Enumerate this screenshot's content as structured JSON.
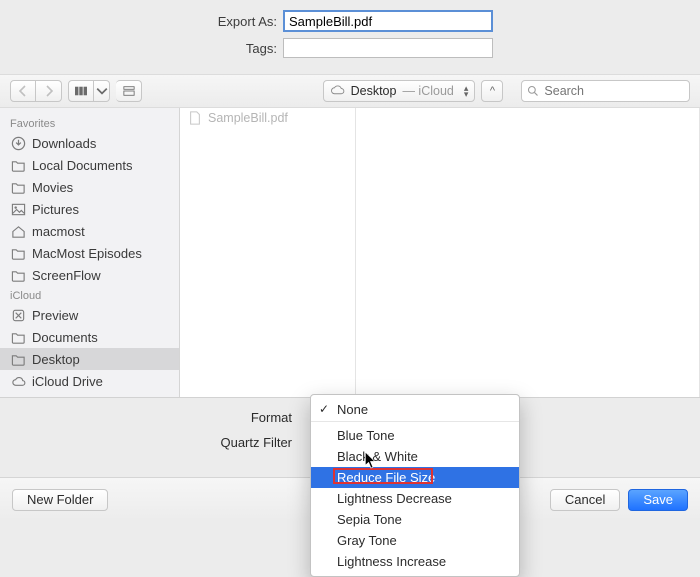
{
  "top": {
    "export_label": "Export As:",
    "export_value": "SampleBill.pdf",
    "tags_label": "Tags:"
  },
  "toolbar": {
    "location_main": "Desktop",
    "location_sub": " — iCloud",
    "search_placeholder": "Search"
  },
  "sidebar": {
    "sections": [
      {
        "header": "Favorites",
        "items": [
          {
            "label": "Downloads",
            "icon": "downloads"
          },
          {
            "label": "Local Documents",
            "icon": "folder"
          },
          {
            "label": "Movies",
            "icon": "folder"
          },
          {
            "label": "Pictures",
            "icon": "pictures"
          },
          {
            "label": "macmost",
            "icon": "home"
          },
          {
            "label": "MacMost Episodes",
            "icon": "folder"
          },
          {
            "label": "ScreenFlow",
            "icon": "folder"
          }
        ]
      },
      {
        "header": "iCloud",
        "items": [
          {
            "label": "Preview",
            "icon": "app"
          },
          {
            "label": "Documents",
            "icon": "folder"
          },
          {
            "label": "Desktop",
            "icon": "folder",
            "selected": true
          },
          {
            "label": "iCloud Drive",
            "icon": "cloud"
          }
        ]
      }
    ]
  },
  "filelist": {
    "items": [
      {
        "label": "SampleBill.pdf"
      }
    ]
  },
  "format": {
    "format_label": "Format",
    "quartz_label": "Quartz Filter"
  },
  "menu": {
    "items": [
      {
        "label": "None",
        "checked": true,
        "separator": true
      },
      {
        "label": "Blue Tone"
      },
      {
        "label": "Black & White"
      },
      {
        "label": "Reduce File Size",
        "selected": true,
        "annotated": true
      },
      {
        "label": "Lightness Decrease"
      },
      {
        "label": "Sepia Tone"
      },
      {
        "label": "Gray Tone"
      },
      {
        "label": "Lightness Increase"
      }
    ]
  },
  "footer": {
    "new_folder": "New Folder",
    "cancel": "Cancel",
    "save": "Save"
  }
}
